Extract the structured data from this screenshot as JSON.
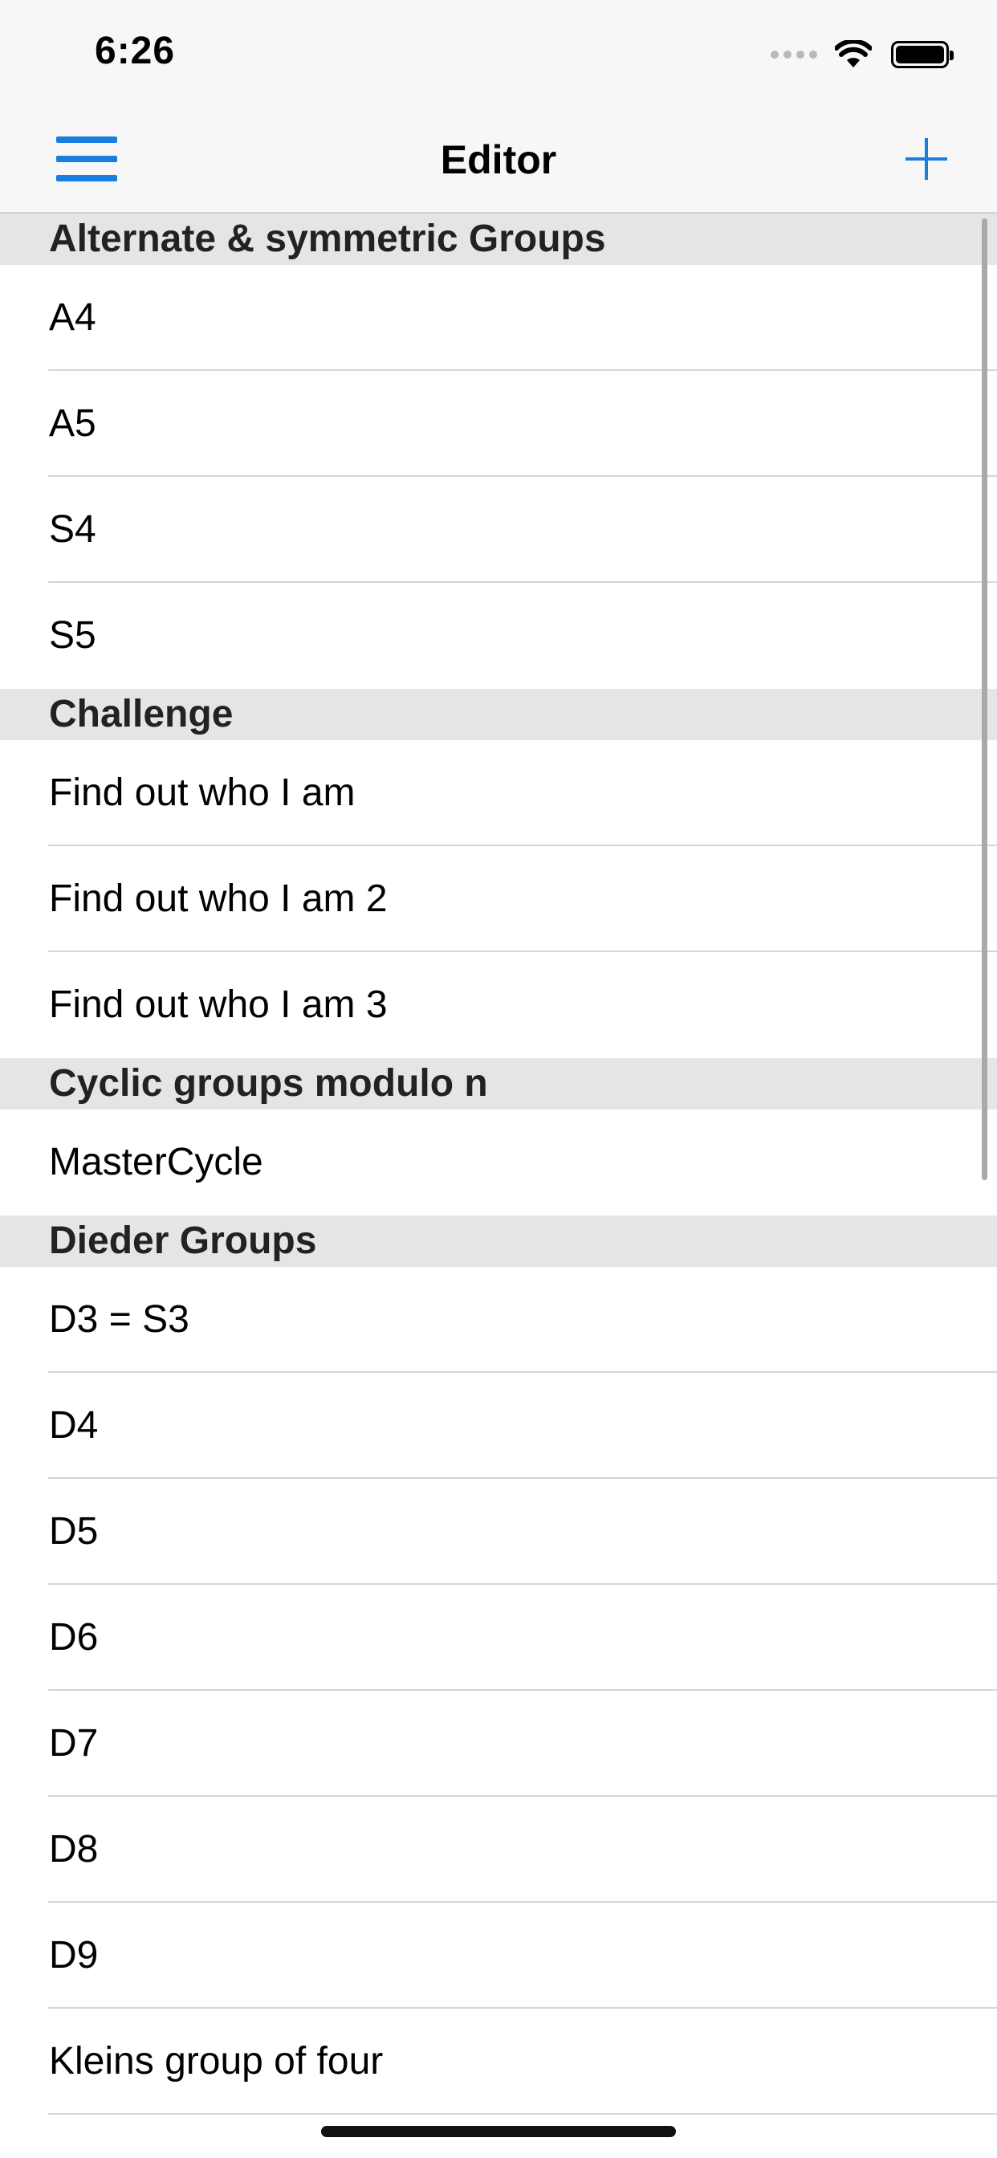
{
  "status": {
    "time": "6:26"
  },
  "nav": {
    "title": "Editor"
  },
  "sections": [
    {
      "header": "Alternate & symmetric Groups",
      "items": [
        "A4",
        "A5",
        "S4",
        "S5"
      ]
    },
    {
      "header": "Challenge",
      "items": [
        "Find out who I am",
        "Find out who I am 2",
        "Find out who I am 3"
      ]
    },
    {
      "header": "Cyclic groups modulo n",
      "items": [
        "MasterCycle"
      ]
    },
    {
      "header": "Dieder Groups",
      "items": [
        "D3 = S3",
        "D4",
        "D5",
        "D6",
        "D7",
        "D8",
        "D9",
        "Kleins group of four"
      ]
    }
  ],
  "colors": {
    "accent": "#1a7de0",
    "section_bg": "#e5e5e5"
  },
  "icons": {
    "menu": "hamburger-icon",
    "add": "plus-icon"
  }
}
